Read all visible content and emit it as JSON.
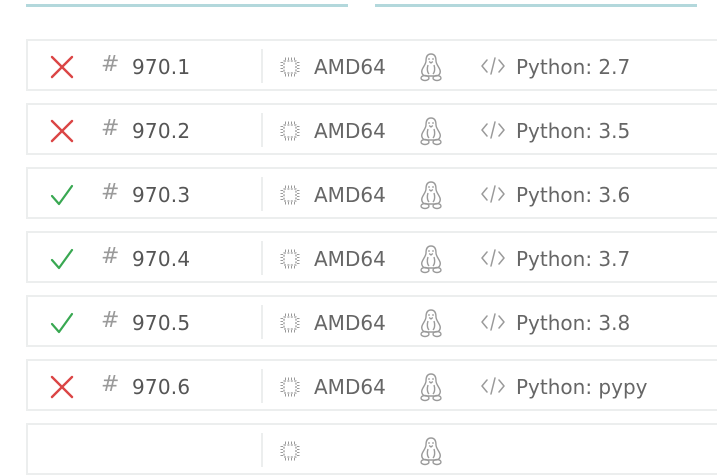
{
  "colors": {
    "failed": "#db4545",
    "passed": "#39a852",
    "tab_underline": "#b3d8dc",
    "border": "#eceeee",
    "icon_gray": "#9a9a9a"
  },
  "jobs": [
    {
      "status": "failed",
      "status_icon": "x-icon",
      "number": "970.1",
      "arch": "AMD64",
      "os_icon": "linux-penguin-icon",
      "language": "Python: 2.7"
    },
    {
      "status": "failed",
      "status_icon": "x-icon",
      "number": "970.2",
      "arch": "AMD64",
      "os_icon": "linux-penguin-icon",
      "language": "Python: 3.5"
    },
    {
      "status": "passed",
      "status_icon": "checkmark-icon",
      "number": "970.3",
      "arch": "AMD64",
      "os_icon": "linux-penguin-icon",
      "language": "Python: 3.6"
    },
    {
      "status": "passed",
      "status_icon": "checkmark-icon",
      "number": "970.4",
      "arch": "AMD64",
      "os_icon": "linux-penguin-icon",
      "language": "Python: 3.7"
    },
    {
      "status": "passed",
      "status_icon": "checkmark-icon",
      "number": "970.5",
      "arch": "AMD64",
      "os_icon": "linux-penguin-icon",
      "language": "Python: 3.8"
    },
    {
      "status": "failed",
      "status_icon": "x-icon",
      "number": "970.6",
      "arch": "AMD64",
      "os_icon": "linux-penguin-icon",
      "language": "Python: pypy"
    }
  ]
}
